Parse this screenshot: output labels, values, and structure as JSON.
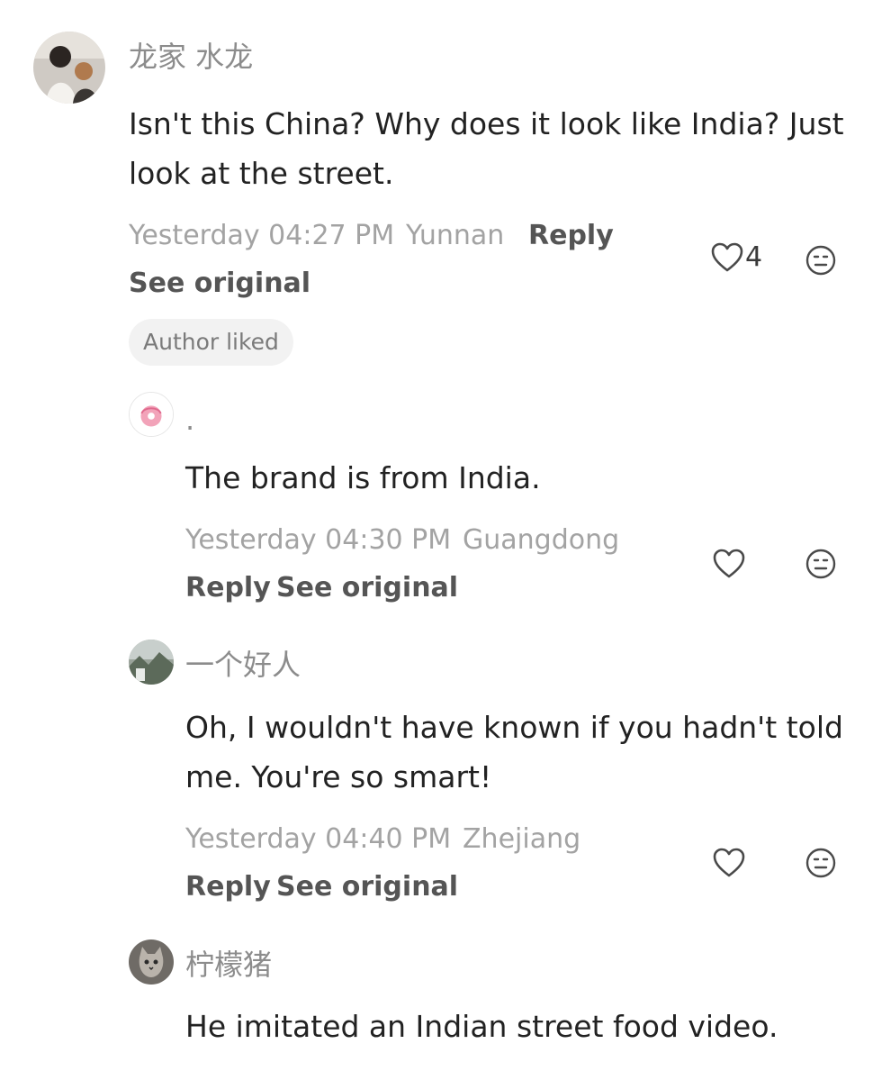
{
  "comments": [
    {
      "username": "龙家 水龙",
      "text": "Isn't this China? Why does it look like India? Just look at the street.",
      "timestamp": "Yesterday 04:27 PM",
      "location": "Yunnan",
      "reply_label": "Reply",
      "see_original_label": "See original",
      "badge": "Author liked",
      "like_count": "4",
      "like_icon": "heart-outline-icon",
      "dislike_icon": "meh-face-icon"
    },
    {
      "username": ".",
      "text": "The brand is from India.",
      "timestamp": "Yesterday 04:30 PM",
      "location": "Guangdong",
      "reply_label": "Reply",
      "see_original_label": "See original",
      "like_icon": "heart-outline-icon",
      "dislike_icon": "meh-face-icon"
    },
    {
      "username": "一个好人",
      "text": "Oh, I wouldn't have known if you hadn't told me. You're so smart!",
      "timestamp": "Yesterday 04:40 PM",
      "location": "Zhejiang",
      "reply_label": "Reply",
      "see_original_label": "See original",
      "like_icon": "heart-outline-icon",
      "dislike_icon": "meh-face-icon"
    },
    {
      "username": "柠檬猪",
      "text": "He imitated an Indian street food video.",
      "like_icon": "heart-outline-icon",
      "dislike_icon": "meh-face-icon"
    }
  ],
  "colors": {
    "username": "#8c8c8c",
    "body": "#222222",
    "meta": "#a3a3a3",
    "action": "#555555",
    "badge_bg": "#f2f2f2"
  }
}
